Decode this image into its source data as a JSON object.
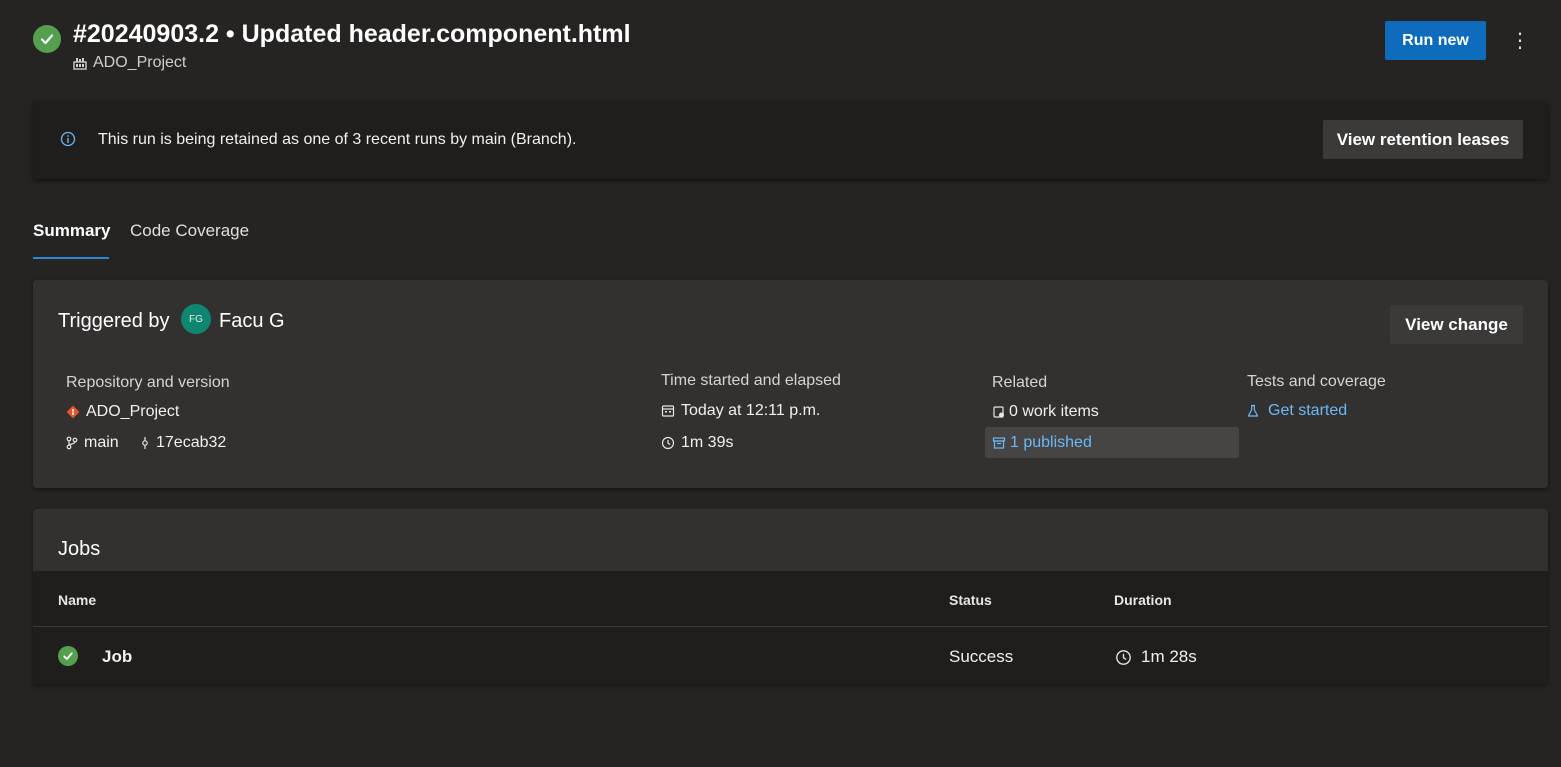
{
  "header": {
    "title": "#20240903.2 • Updated header.component.html",
    "project": "ADO_Project",
    "run_new_label": "Run new",
    "more_label": "⋮"
  },
  "banner": {
    "text": "This run is being retained as one of 3 recent runs by main (Branch).",
    "button_label": "View retention leases"
  },
  "tabs": [
    {
      "label": "Summary",
      "active": true
    },
    {
      "label": "Code Coverage",
      "active": false
    }
  ],
  "summary": {
    "triggered_by_label": "Triggered by",
    "avatar_initials": "FG",
    "user_name": "Facu G",
    "view_change_label": "View change",
    "repository": {
      "heading": "Repository and version",
      "repo_name": "ADO_Project",
      "branch": "main",
      "commit": "17ecab32"
    },
    "time": {
      "heading": "Time started and elapsed",
      "started": "Today at 12:11 p.m.",
      "elapsed": "1m 39s"
    },
    "related": {
      "heading": "Related",
      "work_items": "0 work items",
      "published": "1 published"
    },
    "tests": {
      "heading": "Tests and coverage",
      "get_started": "Get started"
    }
  },
  "jobs": {
    "title": "Jobs",
    "columns": {
      "name": "Name",
      "status": "Status",
      "duration": "Duration"
    },
    "rows": [
      {
        "name": "Job",
        "status": "Success",
        "duration": "1m 28s"
      }
    ]
  },
  "colors": {
    "background": "#252423",
    "accent": "#0f6cbd",
    "success": "#54a04f",
    "link": "#6cb8f6"
  }
}
